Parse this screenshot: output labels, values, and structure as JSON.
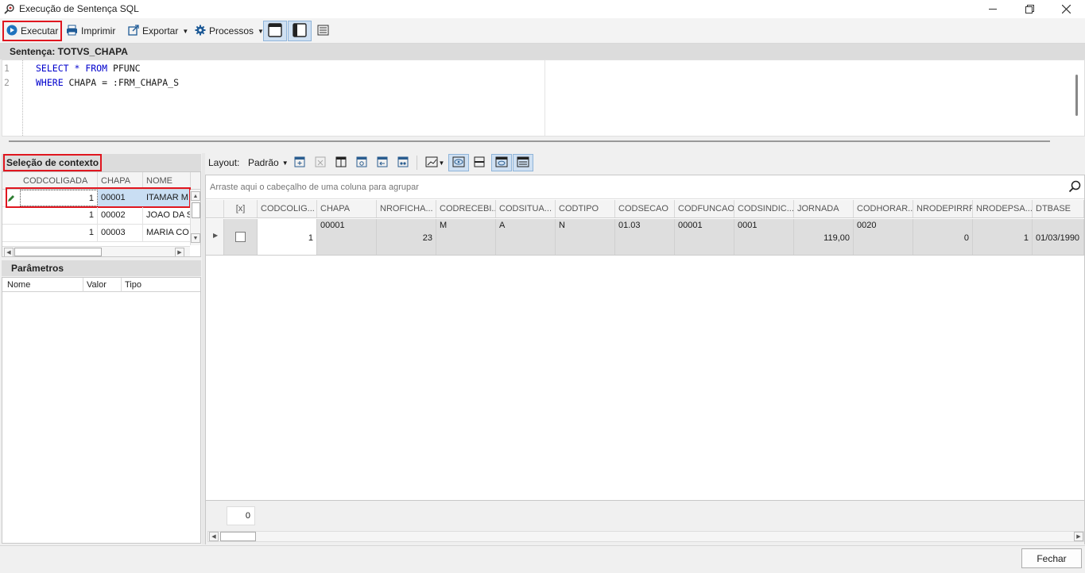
{
  "window": {
    "title": "Execução de Sentença SQL"
  },
  "toolbar": {
    "execute": "Executar",
    "print": "Imprimir",
    "export": "Exportar",
    "processes": "Processos"
  },
  "sentence": {
    "header": "Sentença: TOTVS_CHAPA",
    "lines": [
      {
        "num": "1",
        "kw1": "SELECT",
        "rest1": " * ",
        "kw2": "FROM",
        "rest2": " PFUNC"
      },
      {
        "num": "2",
        "kw1": "WHERE",
        "rest1": " CHAPA = :FRM_CHAPA_S",
        "kw2": "",
        "rest2": ""
      }
    ]
  },
  "context": {
    "header": "Seleção de contexto",
    "columns": [
      "CODCOLIGADA",
      "CHAPA",
      "NOME"
    ],
    "rows": [
      {
        "codcoligada": "1",
        "chapa": "00001",
        "nome": "ITAMAR MI"
      },
      {
        "codcoligada": "1",
        "chapa": "00002",
        "nome": "JOAO DA S"
      },
      {
        "codcoligada": "1",
        "chapa": "00003",
        "nome": "MARIA CO"
      }
    ]
  },
  "params": {
    "header": "Parâmetros",
    "columns": [
      "Nome",
      "Valor",
      "Tipo"
    ]
  },
  "results": {
    "layout_label": "Layout:",
    "layout_value": "Padrão",
    "group_hint": "Arraste aqui o cabeçalho de uma coluna para agrupar",
    "check_header": "[x]",
    "columns": [
      "CODCOLIG...",
      "CHAPA",
      "NROFICHA...",
      "CODRECEBI...",
      "CODSITUA...",
      "CODTIPO",
      "CODSECAO",
      "CODFUNCAO",
      "CODSINDIC...",
      "JORNADA",
      "CODHORAR...",
      "NRODEPIRRF",
      "NRODEPSA...",
      "DTBASE"
    ],
    "row": [
      "1",
      "00001",
      "23",
      "M",
      "A",
      "N",
      "01.03",
      "00001",
      "0001",
      "119,00",
      "0020",
      "0",
      "1",
      "01/03/1990"
    ],
    "count": "0"
  },
  "footer": {
    "close": "Fechar"
  }
}
